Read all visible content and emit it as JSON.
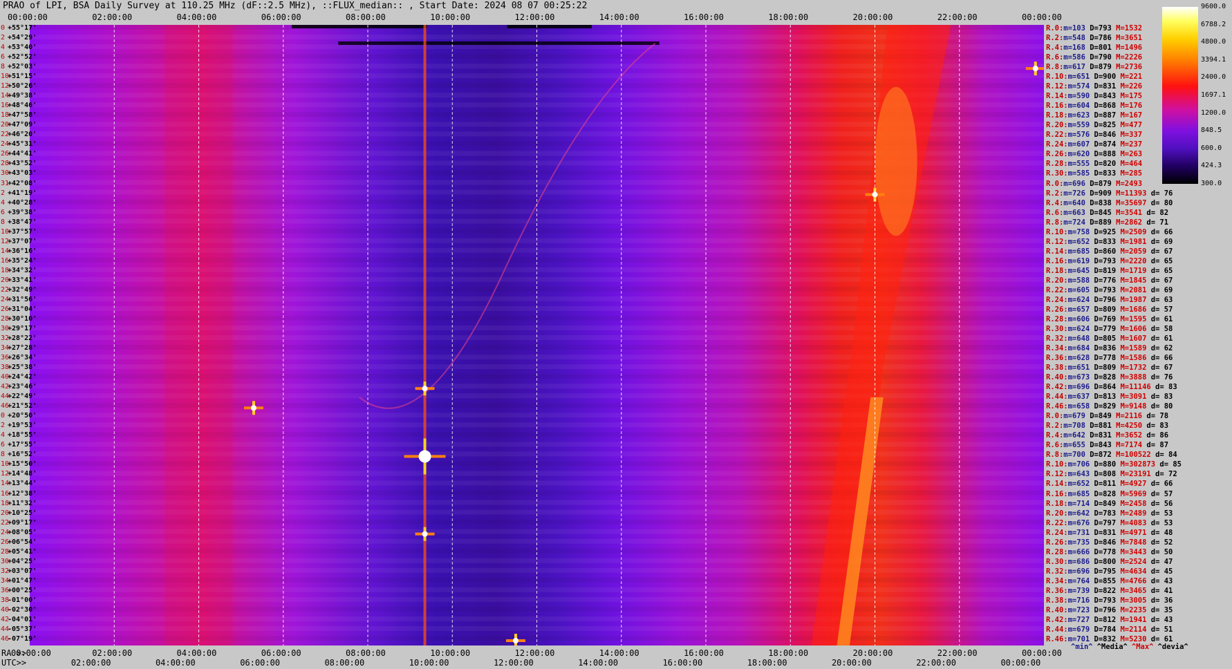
{
  "title": "PRAO of LPI, BSA Daily Survey at 110.25 MHz (dF::2.5 MHz), ::FLUX_median:: , Start Date: 2024 08 07 00:25:22",
  "top_axis_ticks": [
    "00:00:00",
    "02:00:00",
    "04:00:00",
    "06:00:00",
    "08:00:00",
    "10:00:00",
    "12:00:00",
    "14:00:00",
    "16:00:00",
    "18:00:00",
    "20:00:00",
    "22:00:00",
    "00:00:00"
  ],
  "bottom_ra_prefix": "RA >>",
  "bottom_ra_ticks": [
    "00:00:00",
    "02:00:00",
    "04:00:00",
    "06:00:00",
    "08:00:00",
    "10:00:00",
    "12:00:00",
    "14:00:00",
    "16:00:00",
    "18:00:00",
    "20:00:00",
    "22:00:00",
    "00:00:00"
  ],
  "bottom_utc_prefix": "UTC>>",
  "bottom_utc_ticks": [
    "02:00:00",
    "04:00:00",
    "06:00:00",
    "08:00:00",
    "10:00:00",
    "12:00:00",
    "14:00:00",
    "16:00:00",
    "18:00:00",
    "20:00:00",
    "22:00:00",
    "00:00:00"
  ],
  "colorbar": {
    "labels": [
      "9600.0",
      "6788.2",
      "4800.0",
      "3394.1",
      "2400.0",
      "1697.1",
      "1200.0",
      "848.5",
      "600.0",
      "424.3",
      "300.0"
    ]
  },
  "footer_legend": {
    "min": "^min^",
    "media": "^Media^",
    "max": "^Max^",
    "devia": "^devia^"
  },
  "declinations": [
    {
      "i": "0",
      "dec": "+55°17'"
    },
    {
      "i": "2",
      "dec": "+54°29'"
    },
    {
      "i": "4",
      "dec": "+53°40'"
    },
    {
      "i": "6",
      "dec": "+52°52'"
    },
    {
      "i": "8",
      "dec": "+52°03'"
    },
    {
      "i": "10",
      "dec": "+51°15'"
    },
    {
      "i": "12",
      "dec": "+50°26'"
    },
    {
      "i": "14",
      "dec": "+49°38'"
    },
    {
      "i": "16",
      "dec": "+48°46'"
    },
    {
      "i": "18",
      "dec": "+47°58'"
    },
    {
      "i": "20",
      "dec": "+47°09'"
    },
    {
      "i": "22",
      "dec": "+46°20'"
    },
    {
      "i": "24",
      "dec": "+45°31'"
    },
    {
      "i": "26",
      "dec": "+44°41'"
    },
    {
      "i": "28",
      "dec": "+43°52'"
    },
    {
      "i": "30",
      "dec": "+43°03'"
    },
    {
      "i": "31",
      "dec": "+42°08'"
    },
    {
      "i": "2",
      "dec": "+41°19'"
    },
    {
      "i": "4",
      "dec": "+40°28'"
    },
    {
      "i": "6",
      "dec": "+39°38'"
    },
    {
      "i": "8",
      "dec": "+38°47'"
    },
    {
      "i": "10",
      "dec": "+37°57'"
    },
    {
      "i": "12",
      "dec": "+37°07'"
    },
    {
      "i": "14",
      "dec": "+36°16'"
    },
    {
      "i": "16",
      "dec": "+35°24'"
    },
    {
      "i": "18",
      "dec": "+34°32'"
    },
    {
      "i": "20",
      "dec": "+33°41'"
    },
    {
      "i": "22",
      "dec": "+32°49'"
    },
    {
      "i": "24",
      "dec": "+31°56'"
    },
    {
      "i": "26",
      "dec": "+31°04'"
    },
    {
      "i": "28",
      "dec": "+30°10'"
    },
    {
      "i": "30",
      "dec": "+29°17'"
    },
    {
      "i": "32",
      "dec": "+28°22'"
    },
    {
      "i": "34",
      "dec": "+27°28'"
    },
    {
      "i": "36",
      "dec": "+26°34'"
    },
    {
      "i": "38",
      "dec": "+25°38'"
    },
    {
      "i": "40",
      "dec": "+24°42'"
    },
    {
      "i": "42",
      "dec": "+23°46'"
    },
    {
      "i": "44",
      "dec": "+22°49'"
    },
    {
      "i": "46",
      "dec": "+21°52'"
    },
    {
      "i": "0",
      "dec": "+20°50'"
    },
    {
      "i": "2",
      "dec": "+19°53'"
    },
    {
      "i": "4",
      "dec": "+18°55'"
    },
    {
      "i": "6",
      "dec": "+17°55'"
    },
    {
      "i": "8",
      "dec": "+16°52'"
    },
    {
      "i": "10",
      "dec": "+15°50'"
    },
    {
      "i": "12",
      "dec": "+14°48'"
    },
    {
      "i": "14",
      "dec": "+13°44'"
    },
    {
      "i": "16",
      "dec": "+12°38'"
    },
    {
      "i": "18",
      "dec": "+11°32'"
    },
    {
      "i": "20",
      "dec": "+10°25'"
    },
    {
      "i": "22",
      "dec": "+09°17'"
    },
    {
      "i": "24",
      "dec": "+08°05'"
    },
    {
      "i": "26",
      "dec": "+06°54'"
    },
    {
      "i": "28",
      "dec": "+05°41'"
    },
    {
      "i": "30",
      "dec": "+04°25'"
    },
    {
      "i": "32",
      "dec": "+03°07'"
    },
    {
      "i": "34",
      "dec": "+01°47'"
    },
    {
      "i": "36",
      "dec": "+00°25'"
    },
    {
      "i": "38",
      "dec": "-01°00'"
    },
    {
      "i": "40",
      "dec": "-02°30'"
    },
    {
      "i": "42",
      "dec": "-04°01'"
    },
    {
      "i": "44",
      "dec": "-05°37'"
    },
    {
      "i": "46",
      "dec": "-07°19'"
    }
  ],
  "stats": [
    {
      "r": "R.0:",
      "m": "103",
      "D": "793",
      "M": "1532",
      "d": ""
    },
    {
      "r": "R.2:",
      "m": "548",
      "D": "786",
      "M": "3651",
      "d": ""
    },
    {
      "r": "R.4:",
      "m": "168",
      "D": "801",
      "M": "1496",
      "d": ""
    },
    {
      "r": "R.6:",
      "m": "586",
      "D": "790",
      "M": "2226",
      "d": ""
    },
    {
      "r": "R.8:",
      "m": "617",
      "D": "879",
      "M": "2736",
      "d": ""
    },
    {
      "r": "R.10:",
      "m": "651",
      "D": "900",
      "M": "221",
      "d": ""
    },
    {
      "r": "R.12:",
      "m": "574",
      "D": "831",
      "M": "226",
      "d": ""
    },
    {
      "r": "R.14:",
      "m": "590",
      "D": "843",
      "M": "175",
      "d": ""
    },
    {
      "r": "R.16:",
      "m": "604",
      "D": "868",
      "M": "176",
      "d": ""
    },
    {
      "r": "R.18:",
      "m": "623",
      "D": "887",
      "M": "167",
      "d": ""
    },
    {
      "r": "R.20:",
      "m": "559",
      "D": "825",
      "M": "477",
      "d": ""
    },
    {
      "r": "R.22:",
      "m": "576",
      "D": "846",
      "M": "337",
      "d": ""
    },
    {
      "r": "R.24:",
      "m": "607",
      "D": "874",
      "M": "237",
      "d": ""
    },
    {
      "r": "R.26:",
      "m": "620",
      "D": "888",
      "M": "263",
      "d": ""
    },
    {
      "r": "R.28:",
      "m": "555",
      "D": "820",
      "M": "464",
      "d": ""
    },
    {
      "r": "R.30:",
      "m": "585",
      "D": "833",
      "M": "285",
      "d": ""
    },
    {
      "r": "R.0:",
      "m": "696",
      "D": "879",
      "M": "2493",
      "d": ""
    },
    {
      "r": "R.2:",
      "m": "726",
      "D": "909",
      "M": "11393",
      "d": "76"
    },
    {
      "r": "R.4:",
      "m": "640",
      "D": "838",
      "M": "35697",
      "d": "80"
    },
    {
      "r": "R.6:",
      "m": "663",
      "D": "845",
      "M": "3541",
      "d": "82"
    },
    {
      "r": "R.8:",
      "m": "724",
      "D": "889",
      "M": "2862",
      "d": "71"
    },
    {
      "r": "R.10:",
      "m": "758",
      "D": "925",
      "M": "2509",
      "d": "66"
    },
    {
      "r": "R.12:",
      "m": "652",
      "D": "833",
      "M": "1981",
      "d": "69"
    },
    {
      "r": "R.14:",
      "m": "685",
      "D": "860",
      "M": "2059",
      "d": "67"
    },
    {
      "r": "R.16:",
      "m": "619",
      "D": "793",
      "M": "2220",
      "d": "65"
    },
    {
      "r": "R.18:",
      "m": "645",
      "D": "819",
      "M": "1719",
      "d": "65"
    },
    {
      "r": "R.20:",
      "m": "588",
      "D": "776",
      "M": "1845",
      "d": "67"
    },
    {
      "r": "R.22:",
      "m": "605",
      "D": "793",
      "M": "2081",
      "d": "69"
    },
    {
      "r": "R.24:",
      "m": "624",
      "D": "796",
      "M": "1987",
      "d": "63"
    },
    {
      "r": "R.26:",
      "m": "657",
      "D": "809",
      "M": "1686",
      "d": "57"
    },
    {
      "r": "R.28:",
      "m": "606",
      "D": "769",
      "M": "1595",
      "d": "61"
    },
    {
      "r": "R.30:",
      "m": "624",
      "D": "779",
      "M": "1606",
      "d": "58"
    },
    {
      "r": "R.32:",
      "m": "648",
      "D": "805",
      "M": "1607",
      "d": "61"
    },
    {
      "r": "R.34:",
      "m": "684",
      "D": "836",
      "M": "1589",
      "d": "62"
    },
    {
      "r": "R.36:",
      "m": "628",
      "D": "778",
      "M": "1586",
      "d": "66"
    },
    {
      "r": "R.38:",
      "m": "651",
      "D": "809",
      "M": "1732",
      "d": "67"
    },
    {
      "r": "R.40:",
      "m": "673",
      "D": "828",
      "M": "3888",
      "d": "76"
    },
    {
      "r": "R.42:",
      "m": "696",
      "D": "864",
      "M": "11146",
      "d": "83"
    },
    {
      "r": "R.44:",
      "m": "637",
      "D": "813",
      "M": "3091",
      "d": "83"
    },
    {
      "r": "R.46:",
      "m": "658",
      "D": "829",
      "M": "9148",
      "d": "80"
    },
    {
      "r": "R.0:",
      "m": "679",
      "D": "849",
      "M": "2116",
      "d": "78"
    },
    {
      "r": "R.2:",
      "m": "708",
      "D": "881",
      "M": "4250",
      "d": "83"
    },
    {
      "r": "R.4:",
      "m": "642",
      "D": "831",
      "M": "3652",
      "d": "86"
    },
    {
      "r": "R.6:",
      "m": "655",
      "D": "843",
      "M": "7174",
      "d": "87"
    },
    {
      "r": "R.8:",
      "m": "700",
      "D": "872",
      "M": "100522",
      "d": "84"
    },
    {
      "r": "R.10:",
      "m": "706",
      "D": "880",
      "M": "302873",
      "d": "85"
    },
    {
      "r": "R.12:",
      "m": "643",
      "D": "808",
      "M": "23191",
      "d": "72"
    },
    {
      "r": "R.14:",
      "m": "652",
      "D": "811",
      "M": "4927",
      "d": "66"
    },
    {
      "r": "R.16:",
      "m": "685",
      "D": "828",
      "M": "5969",
      "d": "57"
    },
    {
      "r": "R.18:",
      "m": "714",
      "D": "849",
      "M": "2458",
      "d": "56"
    },
    {
      "r": "R.20:",
      "m": "642",
      "D": "783",
      "M": "2489",
      "d": "53"
    },
    {
      "r": "R.22:",
      "m": "676",
      "D": "797",
      "M": "4083",
      "d": "53"
    },
    {
      "r": "R.24:",
      "m": "731",
      "D": "831",
      "M": "4971",
      "d": "48"
    },
    {
      "r": "R.26:",
      "m": "735",
      "D": "846",
      "M": "7848",
      "d": "52"
    },
    {
      "r": "R.28:",
      "m": "666",
      "D": "778",
      "M": "3443",
      "d": "50"
    },
    {
      "r": "R.30:",
      "m": "686",
      "D": "800",
      "M": "2524",
      "d": "47"
    },
    {
      "r": "R.32:",
      "m": "696",
      "D": "795",
      "M": "4634",
      "d": "45"
    },
    {
      "r": "R.34:",
      "m": "764",
      "D": "855",
      "M": "4766",
      "d": "43"
    },
    {
      "r": "R.36:",
      "m": "739",
      "D": "822",
      "M": "3465",
      "d": "41"
    },
    {
      "r": "R.38:",
      "m": "716",
      "D": "793",
      "M": "3005",
      "d": "36"
    },
    {
      "r": "R.40:",
      "m": "723",
      "D": "796",
      "M": "2235",
      "d": "35"
    },
    {
      "r": "R.42:",
      "m": "727",
      "D": "812",
      "M": "1941",
      "d": "43"
    },
    {
      "r": "R.44:",
      "m": "679",
      "D": "784",
      "M": "2114",
      "d": "51"
    },
    {
      "r": "R.46:",
      "m": "701",
      "D": "832",
      "M": "5230",
      "d": "61"
    }
  ],
  "chart_data": {
    "type": "heatmap",
    "title": "PRAO of LPI, BSA Daily Survey at 110.25 MHz (dF::2.5 MHz), ::FLUX_median:: , Start Date: 2024 08 07 00:25:22",
    "x_axis": "RA (hours) / UTC",
    "x_range_hours": [
      0,
      24
    ],
    "y_axis": "Declination",
    "color_scale": [
      300.0,
      9600.0
    ],
    "bright_sources": [
      {
        "ra_hours": 9.35,
        "dec": "+16°52'",
        "level": "max"
      },
      {
        "ra_hours": 20.0,
        "dec": "+41°19'",
        "level": "high"
      },
      {
        "ra_hours": 9.35,
        "dec": "+23°46'",
        "level": "high"
      },
      {
        "ra_hours": 9.35,
        "dec": "+08°05'",
        "level": "high"
      },
      {
        "ra_hours": 11.5,
        "dec": "-07°19'",
        "level": "high"
      },
      {
        "ra_hours": 5.3,
        "dec": "+21°52'",
        "level": "high"
      },
      {
        "ra_hours": 23.8,
        "dec": "+52°03'",
        "level": "high"
      }
    ]
  }
}
